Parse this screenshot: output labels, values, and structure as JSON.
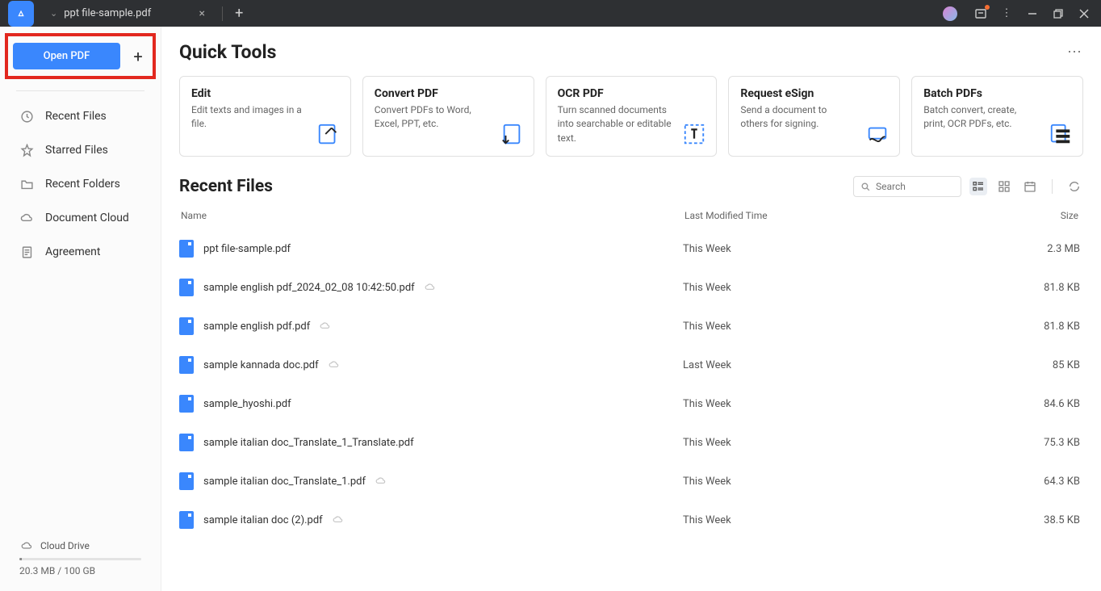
{
  "titlebar": {
    "tab_name": "ppt file-sample.pdf"
  },
  "sidebar": {
    "open_label": "Open PDF",
    "items": [
      {
        "label": "Recent Files"
      },
      {
        "label": "Starred Files"
      },
      {
        "label": "Recent Folders"
      },
      {
        "label": "Document Cloud"
      },
      {
        "label": "Agreement"
      }
    ],
    "cloud_label": "Cloud Drive",
    "cloud_usage": "20.3 MB / 100 GB"
  },
  "quick_tools": {
    "title": "Quick Tools",
    "cards": [
      {
        "title": "Edit",
        "desc": "Edit texts and images in a file."
      },
      {
        "title": "Convert PDF",
        "desc": "Convert PDFs to Word, Excel, PPT, etc."
      },
      {
        "title": "OCR PDF",
        "desc": "Turn scanned documents into searchable or editable text."
      },
      {
        "title": "Request eSign",
        "desc": "Send a document to others for signing."
      },
      {
        "title": "Batch PDFs",
        "desc": "Batch convert, create, print, OCR PDFs, etc."
      }
    ]
  },
  "recent_files": {
    "title": "Recent Files",
    "search_placeholder": "Search",
    "columns": {
      "name": "Name",
      "modified": "Last Modified Time",
      "size": "Size"
    },
    "rows": [
      {
        "name": "ppt file-sample.pdf",
        "modified": "This Week",
        "size": "2.3 MB",
        "cloud": false
      },
      {
        "name": "sample english pdf_2024_02_08 10:42:50.pdf",
        "modified": "This Week",
        "size": "81.8 KB",
        "cloud": true
      },
      {
        "name": "sample english pdf.pdf",
        "modified": "This Week",
        "size": "81.8 KB",
        "cloud": true
      },
      {
        "name": "sample kannada doc.pdf",
        "modified": "Last Week",
        "size": "85 KB",
        "cloud": true
      },
      {
        "name": "sample_hyoshi.pdf",
        "modified": "This Week",
        "size": "84.6 KB",
        "cloud": false
      },
      {
        "name": "sample italian doc_Translate_1_Translate.pdf",
        "modified": "This Week",
        "size": "75.3 KB",
        "cloud": false
      },
      {
        "name": "sample italian doc_Translate_1.pdf",
        "modified": "This Week",
        "size": "64.3 KB",
        "cloud": true
      },
      {
        "name": "sample italian doc (2).pdf",
        "modified": "This Week",
        "size": "38.5 KB",
        "cloud": true
      }
    ]
  }
}
